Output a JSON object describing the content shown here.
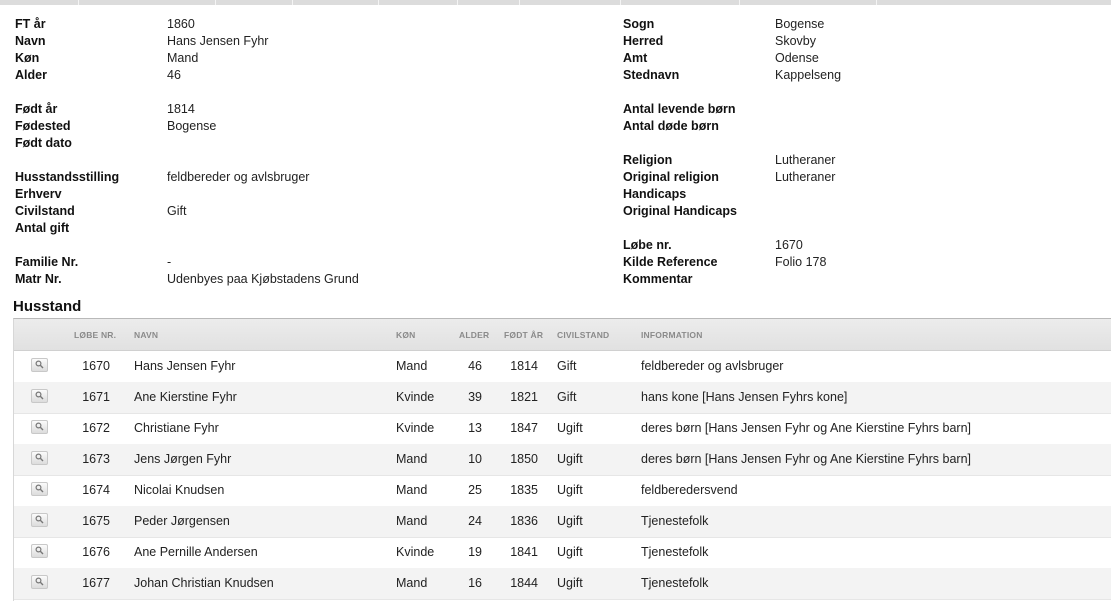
{
  "details": {
    "ft_aar": {
      "label": "FT år",
      "value": "1860"
    },
    "navn": {
      "label": "Navn",
      "value": "Hans Jensen Fyhr"
    },
    "koen": {
      "label": "Køn",
      "value": "Mand"
    },
    "alder": {
      "label": "Alder",
      "value": "46"
    },
    "foedt_aar": {
      "label": "Født år",
      "value": "1814"
    },
    "foedested": {
      "label": "Fødested",
      "value": "Bogense"
    },
    "foedt_dato": {
      "label": "Født dato",
      "value": ""
    },
    "husstandsstilling": {
      "label": "Husstandsstilling",
      "value": "feldbereder og avlsbruger"
    },
    "erhverv": {
      "label": "Erhverv",
      "value": ""
    },
    "civilstand": {
      "label": "Civilstand",
      "value": "Gift"
    },
    "antal_gift": {
      "label": "Antal gift",
      "value": ""
    },
    "familie_nr": {
      "label": "Familie Nr.",
      "value": "-"
    },
    "matr_nr": {
      "label": "Matr Nr.",
      "value": "Udenbyes paa Kjøbstadens Grund"
    },
    "sogn": {
      "label": "Sogn",
      "value": "Bogense"
    },
    "herred": {
      "label": "Herred",
      "value": "Skovby"
    },
    "amt": {
      "label": "Amt",
      "value": "Odense"
    },
    "stednavn": {
      "label": "Stednavn",
      "value": "Kappelseng"
    },
    "antal_levende_boern": {
      "label": "Antal levende børn",
      "value": ""
    },
    "antal_doede_boern": {
      "label": "Antal døde børn",
      "value": ""
    },
    "religion": {
      "label": "Religion",
      "value": "Lutheraner"
    },
    "original_religion": {
      "label": "Original religion",
      "value": "Lutheraner"
    },
    "handicaps": {
      "label": "Handicaps",
      "value": ""
    },
    "original_handicaps": {
      "label": "Original Handicaps",
      "value": ""
    },
    "loebe_nr": {
      "label": "Løbe nr.",
      "value": "1670"
    },
    "kilde_reference": {
      "label": "Kilde Reference",
      "value": "Folio 178"
    },
    "kommentar": {
      "label": "Kommentar",
      "value": ""
    }
  },
  "household": {
    "title": "Husstand",
    "columns": {
      "loebe_nr": "LØBE NR.",
      "navn": "NAVN",
      "koen": "KØN",
      "alder": "ALDER",
      "foedt_aar": "FØDT ÅR",
      "civilstand": "CIVILSTAND",
      "information": "INFORMATION"
    },
    "row_icon": "magnifier-icon",
    "rows": [
      {
        "loebe_nr": "1670",
        "navn": "Hans Jensen Fyhr",
        "koen": "Mand",
        "alder": "46",
        "foedt_aar": "1814",
        "civilstand": "Gift",
        "information": "feldbereder og avlsbruger"
      },
      {
        "loebe_nr": "1671",
        "navn": "Ane Kierstine Fyhr",
        "koen": "Kvinde",
        "alder": "39",
        "foedt_aar": "1821",
        "civilstand": "Gift",
        "information": "hans kone [Hans Jensen Fyhrs kone]"
      },
      {
        "loebe_nr": "1672",
        "navn": "Christiane Fyhr",
        "koen": "Kvinde",
        "alder": "13",
        "foedt_aar": "1847",
        "civilstand": "Ugift",
        "information": "deres børn [Hans Jensen Fyhr og Ane Kierstine Fyhrs barn]"
      },
      {
        "loebe_nr": "1673",
        "navn": "Jens Jørgen Fyhr",
        "koen": "Mand",
        "alder": "10",
        "foedt_aar": "1850",
        "civilstand": "Ugift",
        "information": "deres børn [Hans Jensen Fyhr og Ane Kierstine Fyhrs barn]"
      },
      {
        "loebe_nr": "1674",
        "navn": "Nicolai Knudsen",
        "koen": "Mand",
        "alder": "25",
        "foedt_aar": "1835",
        "civilstand": "Ugift",
        "information": "feldberedersvend"
      },
      {
        "loebe_nr": "1675",
        "navn": "Peder Jørgensen",
        "koen": "Mand",
        "alder": "24",
        "foedt_aar": "1836",
        "civilstand": "Ugift",
        "information": "Tjenestefolk"
      },
      {
        "loebe_nr": "1676",
        "navn": "Ane Pernille Andersen",
        "koen": "Kvinde",
        "alder": "19",
        "foedt_aar": "1841",
        "civilstand": "Ugift",
        "information": "Tjenestefolk"
      },
      {
        "loebe_nr": "1677",
        "navn": "Johan Christian Knudsen",
        "koen": "Mand",
        "alder": "16",
        "foedt_aar": "1844",
        "civilstand": "Ugift",
        "information": "Tjenestefolk"
      }
    ]
  }
}
